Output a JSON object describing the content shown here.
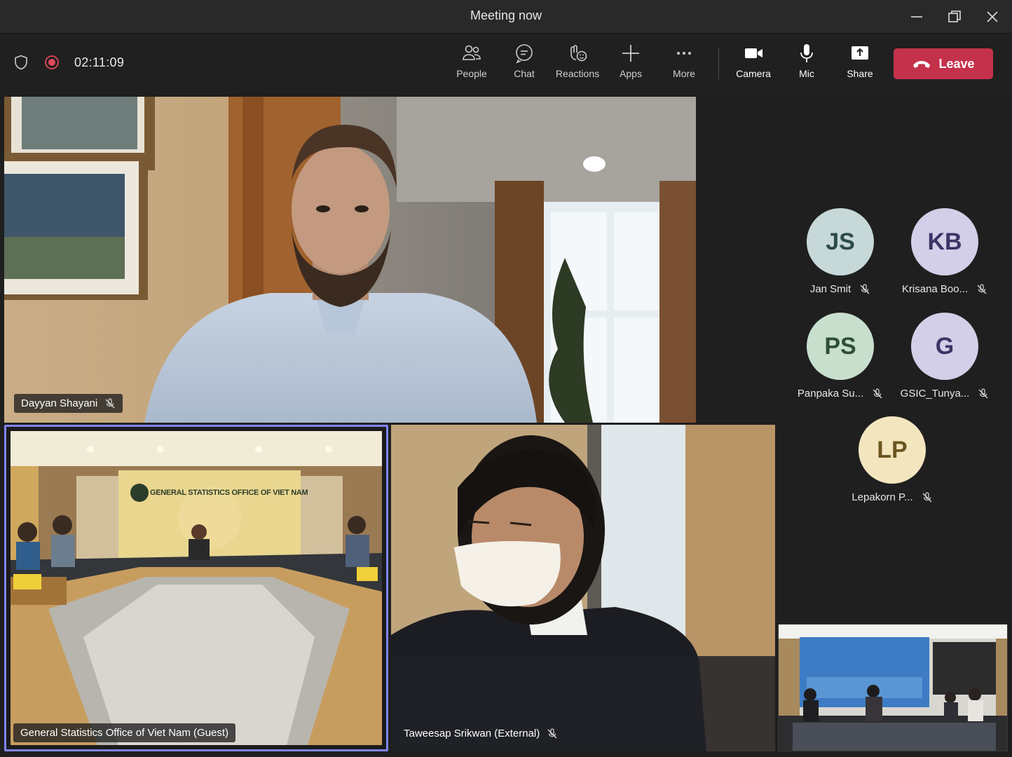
{
  "window": {
    "title": "Meeting now"
  },
  "toolbar": {
    "timer": "02:11:09",
    "buttons": [
      {
        "label": "People",
        "icon": "people-icon"
      },
      {
        "label": "Chat",
        "icon": "chat-icon"
      },
      {
        "label": "Reactions",
        "icon": "reactions-icon"
      },
      {
        "label": "Apps",
        "icon": "plus-icon"
      },
      {
        "label": "More",
        "icon": "more-icon"
      },
      {
        "label": "Camera",
        "icon": "camera-icon"
      },
      {
        "label": "Mic",
        "icon": "mic-icon"
      },
      {
        "label": "Share",
        "icon": "share-icon"
      }
    ],
    "leave_label": "Leave"
  },
  "tiles": {
    "main": {
      "name": "Dayyan Shayani"
    },
    "room": {
      "name": "General Statistics Office of Viet Nam (Guest)",
      "banner": "GENERAL STATISTICS OFFICE OF VIET NAM"
    },
    "third": {
      "name": "Taweesap Srikwan (External)"
    }
  },
  "participants": [
    {
      "initials": "JS",
      "name": "Jan Smit",
      "bg": "#c7d8d8",
      "fg": "#2d4a4a"
    },
    {
      "initials": "KB",
      "name": "Krisana Boo...",
      "bg": "#d3cfe8",
      "fg": "#3a3566"
    },
    {
      "initials": "PS",
      "name": "Panpaka Su...",
      "bg": "#c8dfcd",
      "fg": "#2e5037"
    },
    {
      "initials": "G",
      "name": "GSIC_Tunya...",
      "bg": "#d3cfe8",
      "fg": "#3a3566"
    },
    {
      "initials": "LP",
      "name": "Lepakorn P...",
      "bg": "#f3e6bf",
      "fg": "#6a5520"
    }
  ],
  "colors": {
    "leave": "#c4314b",
    "active_border": "#7f85f5",
    "record": "#e04858"
  }
}
